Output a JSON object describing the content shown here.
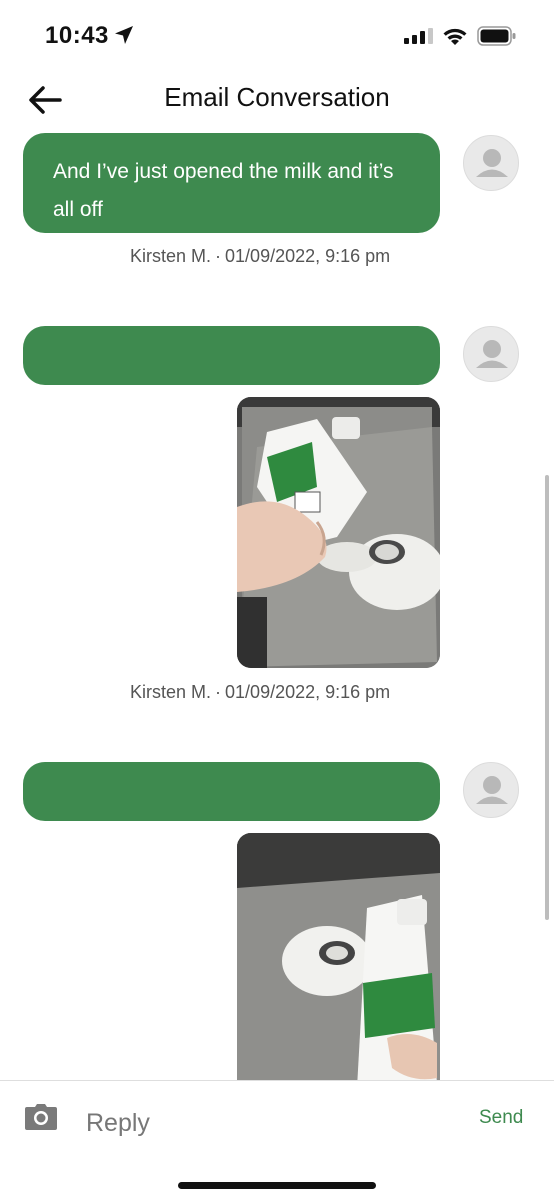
{
  "status_bar": {
    "time": "10:43"
  },
  "header": {
    "title": "Email Conversation"
  },
  "messages": [
    {
      "text": "And I’ve just opened the milk and it’s all off",
      "author": "Kirsten M.",
      "separator": "·",
      "timestamp": "01/09/2022, 9:16 pm"
    },
    {
      "text": "",
      "author": "Kirsten M.",
      "separator": "·",
      "timestamp": "01/09/2022, 9:16 pm"
    },
    {
      "text": ""
    }
  ],
  "reply_bar": {
    "placeholder": "Reply",
    "send_label": "Send"
  },
  "colors": {
    "accent": "#3e8a4f"
  }
}
